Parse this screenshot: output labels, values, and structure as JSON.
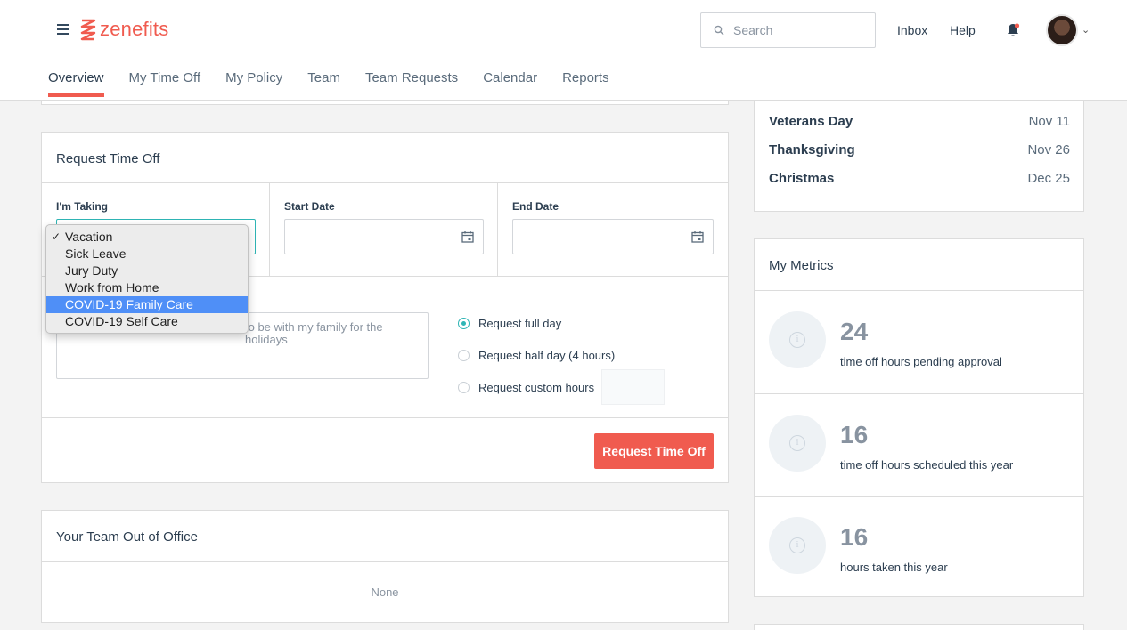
{
  "brand": {
    "name": "zenefits",
    "color": "#f05b4f"
  },
  "header": {
    "search_placeholder": "Search",
    "links": [
      "Inbox",
      "Help"
    ]
  },
  "tabs": [
    {
      "label": "Overview",
      "active": true
    },
    {
      "label": "My Time Off",
      "active": false
    },
    {
      "label": "My Policy",
      "active": false
    },
    {
      "label": "Team",
      "active": false
    },
    {
      "label": "Team Requests",
      "active": false
    },
    {
      "label": "Calendar",
      "active": false
    },
    {
      "label": "Reports",
      "active": false
    }
  ],
  "request": {
    "title": "Request Time Off",
    "taking_label": "I'm Taking",
    "start_label": "Start Date",
    "end_label": "End Date",
    "reason_text": "to be with my family for the holidays",
    "options": [
      {
        "label": "Request full day",
        "selected": true
      },
      {
        "label": "Request half day (4 hours)",
        "selected": false
      },
      {
        "label": "Request custom hours",
        "selected": false
      }
    ],
    "submit_label": "Request Time Off"
  },
  "dropdown": {
    "items": [
      "Vacation",
      "Sick Leave",
      "Jury Duty",
      "Work from Home",
      "COVID-19 Family Care",
      "COVID-19 Self Care"
    ],
    "checked": "Vacation",
    "highlighted": "COVID-19 Family Care"
  },
  "team": {
    "title": "Your Team Out of Office",
    "empty_text": "None"
  },
  "holidays": [
    {
      "name": "Veterans Day",
      "date": "Nov 11"
    },
    {
      "name": "Thanksgiving",
      "date": "Nov 26"
    },
    {
      "name": "Christmas",
      "date": "Dec 25"
    }
  ],
  "metrics": {
    "title": "My Metrics",
    "items": [
      {
        "value": "24",
        "label": "time off hours pending approval"
      },
      {
        "value": "16",
        "label": "time off hours scheduled this year"
      },
      {
        "value": "16",
        "label": "hours taken this year"
      }
    ]
  },
  "accent_color": "#2fb5b5",
  "highlight_color": "#4f8ff7"
}
